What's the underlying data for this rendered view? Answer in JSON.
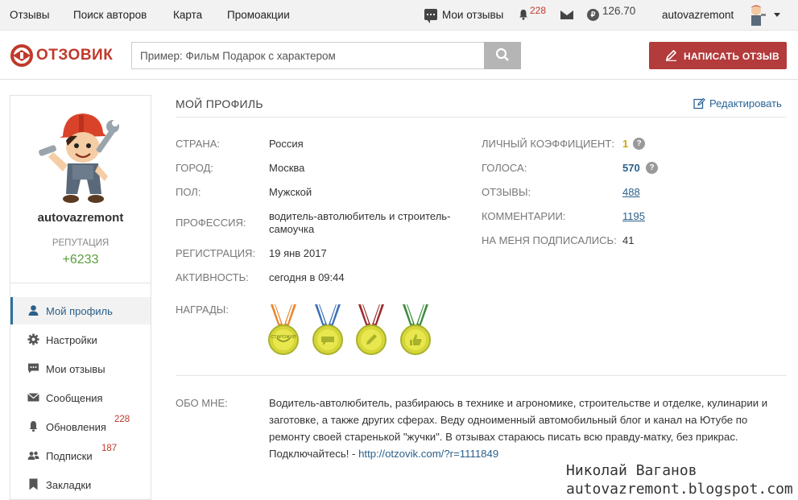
{
  "topbar": {
    "links": [
      "Отзывы",
      "Поиск авторов",
      "Карта",
      "Промоакции"
    ],
    "my_reviews": "Мои отзывы",
    "notifications_count": "228",
    "balance": "126.70",
    "coin_symbol": "₽",
    "username": "autovazremont"
  },
  "header": {
    "logo_text": "ОТЗОВИК",
    "search_placeholder": "Пример: Фильм Подарок с характером",
    "write_button": "НАПИСАТЬ ОТЗЫВ"
  },
  "sidebar": {
    "username": "autovazremont",
    "reputation_label": "РЕПУТАЦИЯ",
    "reputation_value": "+6233",
    "items": [
      {
        "label": "Мой профиль",
        "icon": "user-icon",
        "active": true,
        "badge": ""
      },
      {
        "label": "Настройки",
        "icon": "gear-icon",
        "active": false,
        "badge": ""
      },
      {
        "label": "Мои отзывы",
        "icon": "chat-icon",
        "active": false,
        "badge": ""
      },
      {
        "label": "Сообщения",
        "icon": "envelope-icon",
        "active": false,
        "badge": ""
      },
      {
        "label": "Обновления",
        "icon": "bell-icon",
        "active": false,
        "badge": "228"
      },
      {
        "label": "Подписки",
        "icon": "users-icon",
        "active": false,
        "badge": "187"
      },
      {
        "label": "Закладки",
        "icon": "bookmark-icon",
        "active": false,
        "badge": ""
      }
    ]
  },
  "profile": {
    "title": "МОЙ ПРОФИЛЬ",
    "edit_label": "Редактировать",
    "left_fields": [
      {
        "label": "СТРАНА:",
        "value": "Россия"
      },
      {
        "label": "ГОРОД:",
        "value": "Москва"
      },
      {
        "label": "ПОЛ:",
        "value": "Мужской"
      },
      {
        "label": "ПРОФЕССИЯ:",
        "value": "водитель-автолюбитель и строитель-самоучка"
      },
      {
        "label": "РЕГИСТРАЦИЯ:",
        "value": "19 янв 2017"
      },
      {
        "label": "АКТИВНОСТЬ:",
        "value": "сегодня в 09:44"
      }
    ],
    "right_fields": [
      {
        "label": "ЛИЧНЫЙ КОЭФФИЦИЕНТ:",
        "value": "1"
      },
      {
        "label": "ГОЛОСА:",
        "value": "570"
      },
      {
        "label": "ОТЗЫВЫ:",
        "value": "488"
      },
      {
        "label": "КОММЕНТАРИИ:",
        "value": "1195"
      },
      {
        "label": "НА МЕНЯ ПОДПИСАЛИСЬ:",
        "value": "41"
      }
    ],
    "awards_label": "НАГРАДЫ:",
    "medal_text": "СТАРОЖИЛ",
    "about_label": "ОБО МНЕ:",
    "about_text": "Водитель-автолюбитель, разбираюсь в технике и агрономике, строительстве и отделке, кулинарии и заготовке, а также других сферах. Веду одноименный автомобильный блог и канал на Ютубе по ремонту своей старенькой \"жучки\". В отзывах стараюсь писать всю правду-матку, без прикрас. Подключайтесь! - ",
    "about_link": "http://otzovik.com/?r=1111849"
  },
  "watermark": {
    "line1": "Николай Ваганов",
    "line2": "autovazremont.blogspot.com"
  },
  "colors": {
    "brand_red": "#b33b3b",
    "link_blue": "#2a5f8a",
    "reputation_green": "#5a9e3a",
    "badge_red": "#c0392b"
  }
}
